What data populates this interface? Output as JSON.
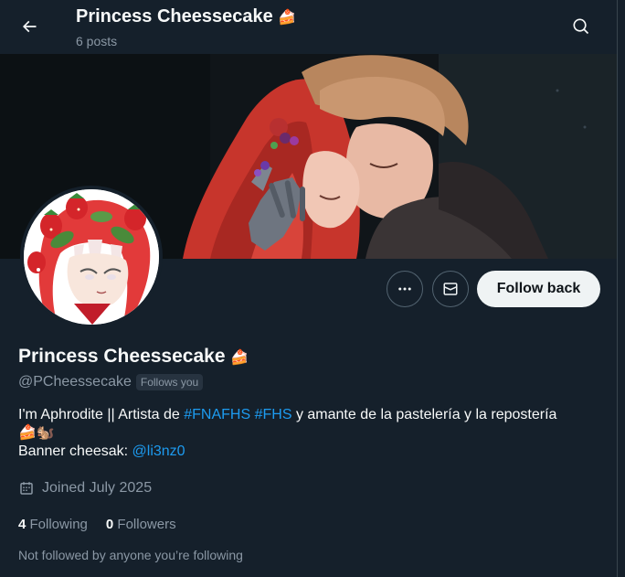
{
  "header": {
    "title": "Princess Cheessecake",
    "title_emoji": "🍰",
    "posts_count": "6 posts",
    "back_icon": "arrow-left-icon",
    "search_icon": "search-icon"
  },
  "profile": {
    "name": "Princess Cheessecake",
    "name_emoji": "🍰",
    "handle": "@PCheessecake",
    "follows_you": "Follows you",
    "bio": {
      "prefix": "I'm Aphrodite || Artista de ",
      "hashtag1": "#FNAFHS",
      "hashtag2": "#FHS",
      "suffix": " y amante de la pastelería y la repostería",
      "emojis": "🍰🐿️",
      "banner_label": "Banner cheesak: ",
      "banner_link": "@li3nz0"
    },
    "joined": "Joined July 2025",
    "following_count": "4",
    "following_label": "Following",
    "followers_count": "0",
    "followers_label": "Followers",
    "not_followed": "Not followed by anyone you’re following"
  },
  "actions": {
    "follow_back": "Follow back",
    "more_icon": "more-icon",
    "message_icon": "mail-icon"
  },
  "colors": {
    "background": "#15202b",
    "accent": "#1d9bf0",
    "muted": "#8b98a5",
    "button_bg": "#eff3f4"
  }
}
